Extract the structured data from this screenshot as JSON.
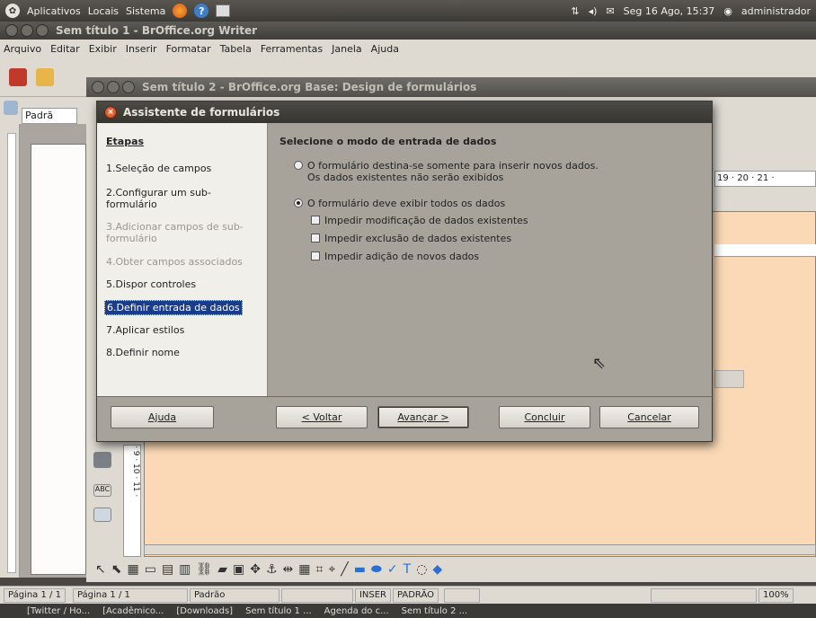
{
  "top_panel": {
    "menus": [
      "Aplicativos",
      "Locais",
      "Sistema"
    ],
    "clock": "Seg 16 Ago, 15:37",
    "user": "administrador"
  },
  "writer": {
    "title": "Sem título 1 - BrOffice.org Writer",
    "menu": [
      "Arquivo",
      "Editar",
      "Exibir",
      "Inserir",
      "Formatar",
      "Tabela",
      "Ferramentas",
      "Janela",
      "Ajuda"
    ],
    "style_combo": "Padrã",
    "status": {
      "page": "Página 1 / 1"
    }
  },
  "base": {
    "title": "Sem título 2 - BrOffice.org Base: Design de formulários",
    "ruler_text": "19 · 20 · 21 ·",
    "vruler_text": "· 9 · 10 · 11 ·",
    "status": {
      "page": "Página 1 / 1",
      "style": "Padrão",
      "mode": "INSER",
      "sel": "PADRÃO",
      "zoom": "100%"
    }
  },
  "taskbar": {
    "items": [
      "[Twitter / Ho...",
      "[Acadêmico...",
      "[Downloads]",
      "Sem título 1 ...",
      "Agenda do c...",
      "Sem título 2 ..."
    ]
  },
  "dialog": {
    "title": "Assistente de formulários",
    "steps_header": "Etapas",
    "steps": [
      {
        "label": "1.Seleção de campos",
        "state": "normal"
      },
      {
        "label": "2.Configurar um sub-formulário",
        "state": "normal"
      },
      {
        "label": "3.Adicionar campos de sub-formulário",
        "state": "dim"
      },
      {
        "label": "4.Obter campos associados",
        "state": "dim"
      },
      {
        "label": "5.Dispor controles",
        "state": "normal"
      },
      {
        "label": "6.Definir entrada de dados",
        "state": "selected"
      },
      {
        "label": "7.Aplicar estilos",
        "state": "normal"
      },
      {
        "label": "8.Definir nome",
        "state": "normal"
      }
    ],
    "heading": "Selecione o modo de entrada de dados",
    "option_new_only": "O formulário destina-se somente para inserir novos dados.",
    "option_new_only_note": "Os dados existentes não serão exibidos",
    "option_all": "O formulário deve exibir todos os dados",
    "checks": [
      "Impedir modificação de dados existentes",
      "Impedir exclusão de dados existentes",
      "Impedir adição de novos dados"
    ],
    "buttons": {
      "help": "Ajuda",
      "back": "< Voltar",
      "next": "Avançar >",
      "finish": "Concluir",
      "cancel": "Cancelar"
    }
  }
}
